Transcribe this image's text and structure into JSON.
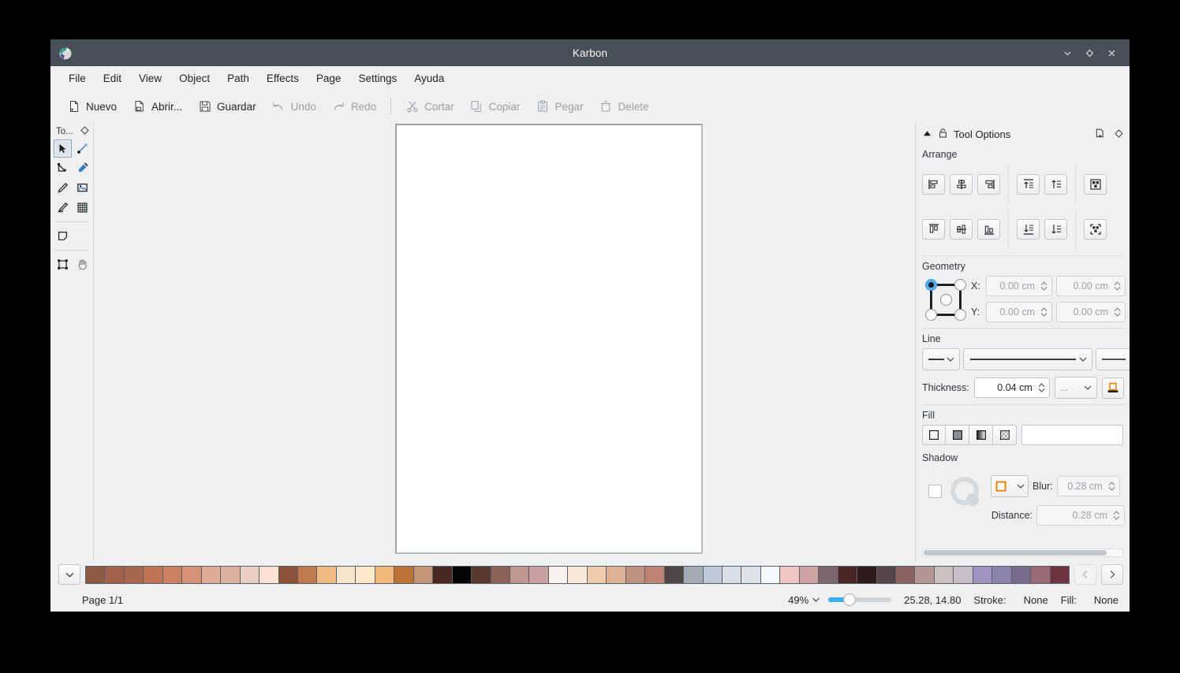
{
  "window": {
    "title": "Karbon",
    "app_icon": "karbon-app-icon",
    "controls": [
      {
        "name": "minimize-button",
        "glyph": "chevron-down"
      },
      {
        "name": "maximize-button",
        "glyph": "diamond"
      },
      {
        "name": "close-button",
        "glyph": "cross"
      }
    ]
  },
  "menubar": {
    "items": [
      {
        "label": "File"
      },
      {
        "label": "Edit"
      },
      {
        "label": "View"
      },
      {
        "label": "Object"
      },
      {
        "label": "Path"
      },
      {
        "label": "Effects"
      },
      {
        "label": "Page"
      },
      {
        "label": "Settings"
      },
      {
        "label": "Ayuda"
      }
    ]
  },
  "toolbar": {
    "items": [
      {
        "label": "Nuevo",
        "icon": "new-document-icon",
        "enabled": true
      },
      {
        "label": "Abrir...",
        "icon": "open-folder-icon",
        "enabled": true
      },
      {
        "label": "Guardar",
        "icon": "save-floppy-icon",
        "enabled": true
      },
      {
        "label": "Undo",
        "icon": "undo-arrow-icon",
        "enabled": false
      },
      {
        "label": "Redo",
        "icon": "redo-arrow-icon",
        "enabled": false
      },
      {
        "label": "Cortar",
        "icon": "scissors-icon",
        "enabled": false
      },
      {
        "label": "Copiar",
        "icon": "copy-pages-icon",
        "enabled": false
      },
      {
        "label": "Pegar",
        "icon": "clipboard-paste-icon",
        "enabled": false
      },
      {
        "label": "Delete",
        "icon": "trash-bin-icon",
        "enabled": false
      }
    ]
  },
  "toolbox": {
    "title": "To...",
    "float_icon": "float-diamond-icon",
    "tools": [
      {
        "name": "select-tool",
        "icon": "cursor-arrow-icon",
        "selected": true
      },
      {
        "name": "gradient-tool",
        "icon": "gradient-line-icon",
        "selected": false
      },
      {
        "name": "path-edit-tool",
        "icon": "node-edit-icon",
        "selected": false
      },
      {
        "name": "color-picker-tool",
        "icon": "eyedropper-icon",
        "selected": false
      },
      {
        "name": "pencil-tool",
        "icon": "pencil-icon",
        "selected": false
      },
      {
        "name": "image-tool",
        "icon": "image-frame-icon",
        "selected": false
      },
      {
        "name": "calligraphy-tool",
        "icon": "calligraphy-pen-icon",
        "selected": false
      },
      {
        "name": "pattern-tool",
        "icon": "grid-pattern-icon",
        "selected": false
      },
      {
        "name": "shape-tool",
        "icon": "shape-pentagon-icon",
        "selected": false
      },
      {
        "name": "transform-tool",
        "icon": "transform-handles-icon",
        "selected": false
      },
      {
        "name": "pan-tool",
        "icon": "hand-pan-icon",
        "selected": false
      }
    ]
  },
  "docker": {
    "title": "Tool Options",
    "collapse_icon": "collapse-triangle-icon",
    "lock_icon": "lock-padlock-icon",
    "undock_icon": "undock-window-icon",
    "float_icon": "float-diamond-icon",
    "arrange": {
      "label": "Arrange",
      "buttons": [
        {
          "name": "align-left-button",
          "icon": "align-left-icon"
        },
        {
          "name": "align-center-h-button",
          "icon": "align-center-horizontal-icon"
        },
        {
          "name": "align-right-button",
          "icon": "align-right-icon"
        },
        {
          "name": "align-top-button",
          "icon": "align-top-icon"
        },
        {
          "name": "align-center-v-button",
          "icon": "align-center-vertical-icon"
        },
        {
          "name": "align-bottom-button",
          "icon": "align-bottom-icon"
        },
        {
          "name": "raise-to-top-button",
          "icon": "raise-to-top-icon"
        },
        {
          "name": "raise-button",
          "icon": "raise-one-icon"
        },
        {
          "name": "lower-to-bottom-button",
          "icon": "lower-to-bottom-icon"
        },
        {
          "name": "lower-button",
          "icon": "lower-one-icon"
        },
        {
          "name": "group-button",
          "icon": "group-objects-icon"
        },
        {
          "name": "ungroup-button",
          "icon": "ungroup-objects-icon"
        }
      ]
    },
    "geometry": {
      "label": "Geometry",
      "anchor_selected": "top-left",
      "x_label": "X:",
      "y_label": "Y:",
      "x_value": "0.00 cm",
      "width_value": "0.00 cm",
      "y_value": "0.00 cm",
      "height_value": "0.00 cm"
    },
    "line": {
      "label": "Line",
      "cap_style": "line-cap-dropdown",
      "style_preview": "solid-line-style",
      "marker_preview": "line-marker"
    },
    "thickness": {
      "label": "Thickness:",
      "value": "0.04 cm",
      "unit_placeholder": "...",
      "cap_button_icon": "line-end-style-icon"
    },
    "fill": {
      "label": "Fill",
      "buttons": [
        {
          "name": "fill-solid-button",
          "icon": "solid-fill-icon"
        },
        {
          "name": "fill-gray-button",
          "icon": "gray-fill-icon"
        },
        {
          "name": "fill-gradient-button",
          "icon": "gradient-fill-icon"
        },
        {
          "name": "fill-pattern-button",
          "icon": "checker-pattern-icon"
        }
      ],
      "color_preview": "#ffffff"
    },
    "shadow": {
      "label": "Shadow",
      "enabled": false,
      "angle_widget": "shadow-angle-dial",
      "color_swatch": "#e8820c",
      "blur_label": "Blur:",
      "blur_value": "0.28 cm",
      "distance_label": "Distance:",
      "distance_value": "0.28 cm"
    }
  },
  "palette": {
    "dropdown_icon": "chevron-down-icon",
    "prev_icon": "chevron-left-icon",
    "next_icon": "chevron-right-icon",
    "colors": [
      "#8f5a43",
      "#a0624a",
      "#a8674d",
      "#bd7354",
      "#cc8063",
      "#d89176",
      "#ddab96",
      "#dcb19f",
      "#ead0c2",
      "#fae0d5",
      "#8b5339",
      "#c0794f",
      "#efba84",
      "#f7e4cd",
      "#fde9c8",
      "#f1b87a",
      "#bd7335",
      "#c39577",
      "#4a2620",
      "#050505",
      "#57392f",
      "#8a6258",
      "#bf9590",
      "#c9a0a0",
      "#faf1f0",
      "#f8e8d9",
      "#ecccab",
      "#ddb193",
      "#bf9183",
      "#c08272",
      "#4f4546",
      "#a3abb6",
      "#bdc9d6",
      "#d7dee8",
      "#dde2ea",
      "#f5f8fc",
      "#eec5c3",
      "#ccA3A1",
      "#7d6770",
      "#4b2424",
      "#2d1b1b",
      "#56464a",
      "#8a6360",
      "#b19692",
      "#cdc0c0",
      "#c8bccb",
      "#9f93c2",
      "#8b82ac",
      "#796a8e",
      "#9b6b78",
      "#6e3540"
    ]
  },
  "statusbar": {
    "page_label": "Page 1/1",
    "zoom_value": "49%",
    "zoom_dropdown_icon": "chevron-down-icon",
    "coordinates": "25.28, 14.80",
    "stroke_label": "Stroke:",
    "stroke_value": "None",
    "fill_label": "Fill:",
    "fill_value": "None"
  }
}
